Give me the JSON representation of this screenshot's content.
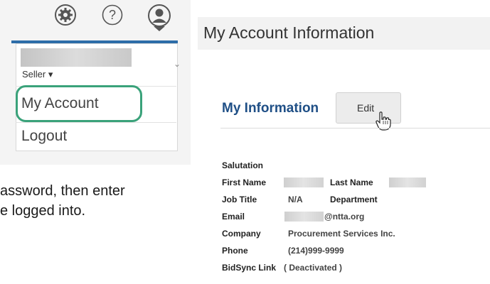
{
  "header": {
    "icons": [
      "gear-icon",
      "help-icon",
      "user-icon"
    ],
    "accent_color": "#2d6da8"
  },
  "dropdown": {
    "role_label": "Seller ▾",
    "my_account": "My Account",
    "logout": "Logout",
    "highlight_color": "#3aa27a"
  },
  "body_text": {
    "line1": "assword, then enter",
    "line2": "e logged into."
  },
  "page": {
    "title": "My Account Information"
  },
  "my_information": {
    "section_title": "My Information",
    "edit_label": "Edit",
    "fields": {
      "salutation": "Salutation",
      "first_name": "First Name",
      "last_name": "Last Name",
      "job_title": "Job Title",
      "job_title_value": "N/A",
      "department": "Department",
      "email": "Email",
      "email_value": "@ntta.org",
      "company": "Company",
      "company_value": "Procurement Services Inc.",
      "phone": "Phone",
      "phone_value": "(214)999-9999",
      "bidsync_link": "BidSync Link",
      "bidsync_value": "( Deactivated )"
    },
    "title_color": "#1f4f86"
  }
}
